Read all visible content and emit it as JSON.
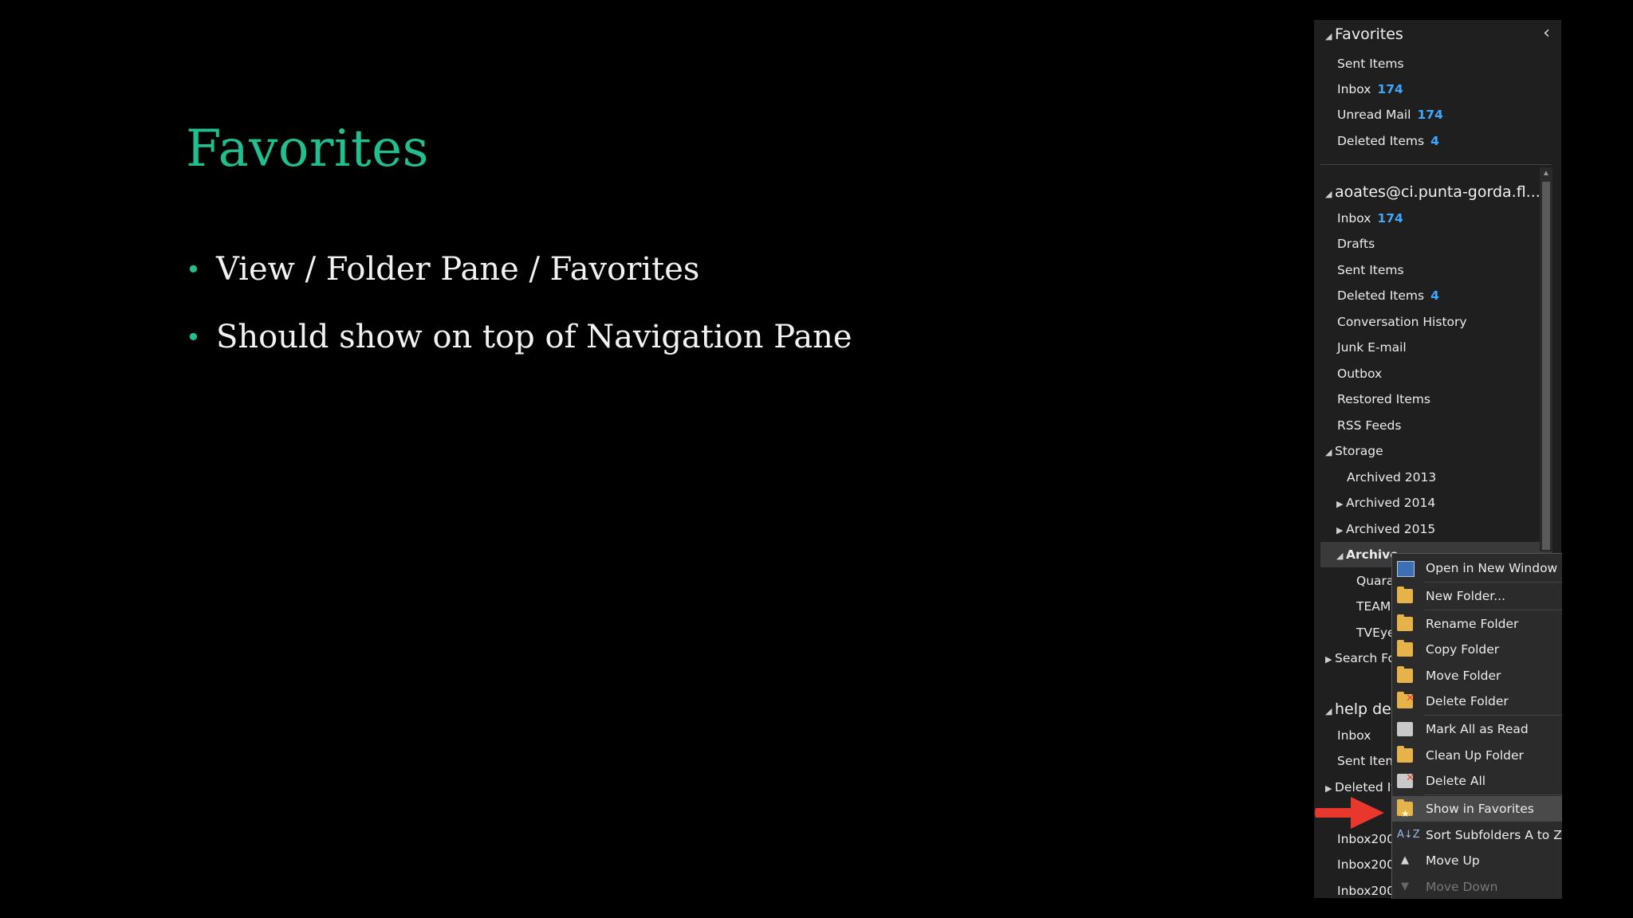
{
  "slide": {
    "title": "Favorites",
    "bullets": [
      "View / Folder Pane / Favorites",
      "Should show on top of Navigation Pane"
    ]
  },
  "pane": {
    "collapse_glyph": "‹",
    "favorites": {
      "header": "Favorites",
      "items": [
        {
          "label": "Sent Items",
          "count": ""
        },
        {
          "label": "Inbox",
          "count": "174"
        },
        {
          "label": "Unread Mail",
          "count": "174"
        },
        {
          "label": "Deleted Items",
          "count": "4"
        }
      ]
    },
    "account": {
      "header": "aoates@ci.punta-gorda.fl....",
      "items": [
        {
          "label": "Inbox",
          "count": "174"
        },
        {
          "label": "Drafts",
          "count": ""
        },
        {
          "label": "Sent Items",
          "count": ""
        },
        {
          "label": "Deleted Items",
          "count": "4"
        },
        {
          "label": "Conversation History",
          "count": ""
        },
        {
          "label": "Junk E-mail",
          "count": ""
        },
        {
          "label": "Outbox",
          "count": ""
        },
        {
          "label": "Restored Items",
          "count": ""
        },
        {
          "label": "RSS Feeds",
          "count": ""
        }
      ],
      "storage": {
        "label": "Storage",
        "children": [
          "Archived 2013",
          "Archived 2014",
          "Archived 2015"
        ],
        "selected": "Archive",
        "selected_children": [
          "Quara",
          "TEAM",
          "TVEye"
        ]
      },
      "search_folders": "Search Fo"
    },
    "help": {
      "header": "help de",
      "items": [
        "Inbox",
        "Sent Item",
        "Deleted It",
        "Inbox200",
        "Inbox200",
        "Inbox200"
      ]
    }
  },
  "menu": {
    "items": [
      {
        "label": "Open in New Window",
        "icon": "open-window-icon"
      },
      {
        "label": "New Folder...",
        "icon": "new-folder-icon"
      },
      {
        "label": "Rename Folder",
        "icon": "rename-folder-icon"
      },
      {
        "label": "Copy Folder",
        "icon": "copy-folder-icon"
      },
      {
        "label": "Move Folder",
        "icon": "move-folder-icon"
      },
      {
        "label": "Delete Folder",
        "icon": "delete-folder-icon"
      },
      {
        "label": "Mark All as Read",
        "icon": "mark-read-icon"
      },
      {
        "label": "Clean Up Folder",
        "icon": "clean-up-icon"
      },
      {
        "label": "Delete All",
        "icon": "delete-all-icon"
      },
      {
        "label": "Show in Favorites",
        "icon": "favorites-folder-icon"
      },
      {
        "label": "Sort Subfolders A to Z",
        "icon": "sort-az-icon"
      },
      {
        "label": "Move Up",
        "icon": "move-up-icon"
      },
      {
        "label": "Move Down",
        "icon": "move-down-icon"
      }
    ],
    "sort_glyph": "A↓Z",
    "up_glyph": "▲",
    "down_glyph": "▼"
  },
  "colors": {
    "accent": "#1fbf8f",
    "count": "#3ea8ff",
    "arrow": "#e8372c"
  }
}
